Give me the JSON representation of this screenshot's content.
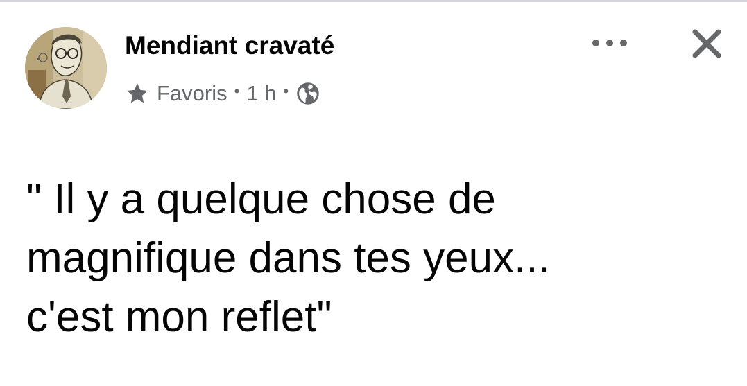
{
  "post": {
    "author": {
      "name": "Mendiant cravaté",
      "avatar_icon": "profile-sketch-avatar"
    },
    "meta": {
      "star_icon": "star-icon",
      "audience_label": "Favoris",
      "separator": "•",
      "time": "1 h",
      "privacy_icon": "globe-icon"
    },
    "actions": {
      "more_icon": "more-horizontal-icon",
      "close_icon": "close-icon"
    },
    "text_lines": [
      "\" Il y a quelque chose de",
      "magnifique dans tes yeux...",
      "c'est mon reflet\""
    ]
  },
  "colors": {
    "text_primary": "#050505",
    "text_secondary": "#65676b",
    "background": "#ffffff",
    "divider": "#d3d6da"
  }
}
